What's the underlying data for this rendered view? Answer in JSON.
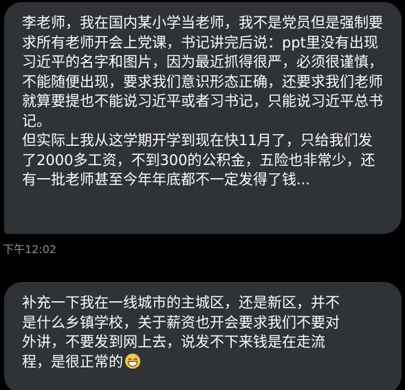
{
  "messages": [
    {
      "text": "李老师，我在国内某小学当老师，我不是党员但是强制要求所有老师开会上党课，书记讲完后说：ppt里没有出现习近平的名字和图片，因为最近抓得很严，必须很谨慎，不能随便出现，要求我们意识形态正确，还要求我们老师就算要提也不能说习近平或者习书记，只能说习近平总书记。\n但实际上我从这学期开学到现在快11月了，只给我们发了2000多工资，不到300的公积金，五险也非常少，还有一批老师甚至今年年底都不一定发得了钱...",
      "time": "下午12:02"
    },
    {
      "text": "补充一下我在一线城市的主城区，还是新区，并不是什么乡镇学校，关于薪资也开会要求我们不要对外讲，不要发到网上去，说发不下来钱是在走流程，是很正常的",
      "emoji": "grinning-face-with-sweat-icon"
    }
  ],
  "colors": {
    "background": "#000000",
    "bubble": "#2f3236",
    "text": "#ffffff",
    "timestamp": "#8a8d91"
  }
}
